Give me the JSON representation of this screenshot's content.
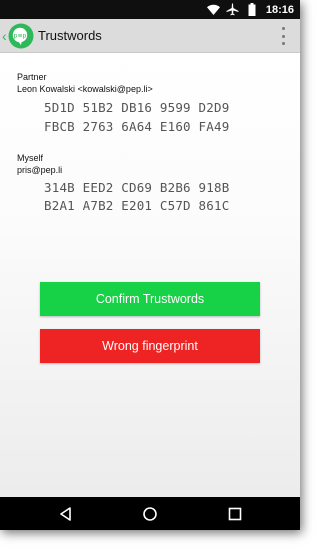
{
  "status_bar": {
    "time": "18:16",
    "icons": [
      "wifi-icon",
      "airplane-mode-icon",
      "battery-icon"
    ]
  },
  "app_bar": {
    "title": "Trustwords",
    "logo_icon": "pep-logo-icon",
    "menu_icon": "overflow-menu-icon"
  },
  "partner": {
    "label": "Partner",
    "name": "Leon Kowalski <kowalski@pep.li>",
    "fingerprint_rows": [
      "5D1D 51B2 DB16 9599 D2D9",
      "FBCB 2763 6A64 E160 FA49"
    ]
  },
  "myself": {
    "label": "Myself",
    "name": "pris@pep.li",
    "fingerprint_rows": [
      "314B EED2 CD69 B2B6 918B",
      "B2A1 A7B2 E201 C57D 861C"
    ]
  },
  "actions": {
    "confirm_label": "Confirm Trustwords",
    "wrong_label": "Wrong fingerprint"
  },
  "colors": {
    "confirm": "#17d146",
    "wrong": "#ee2323",
    "brand_green": "#2fb85a"
  }
}
